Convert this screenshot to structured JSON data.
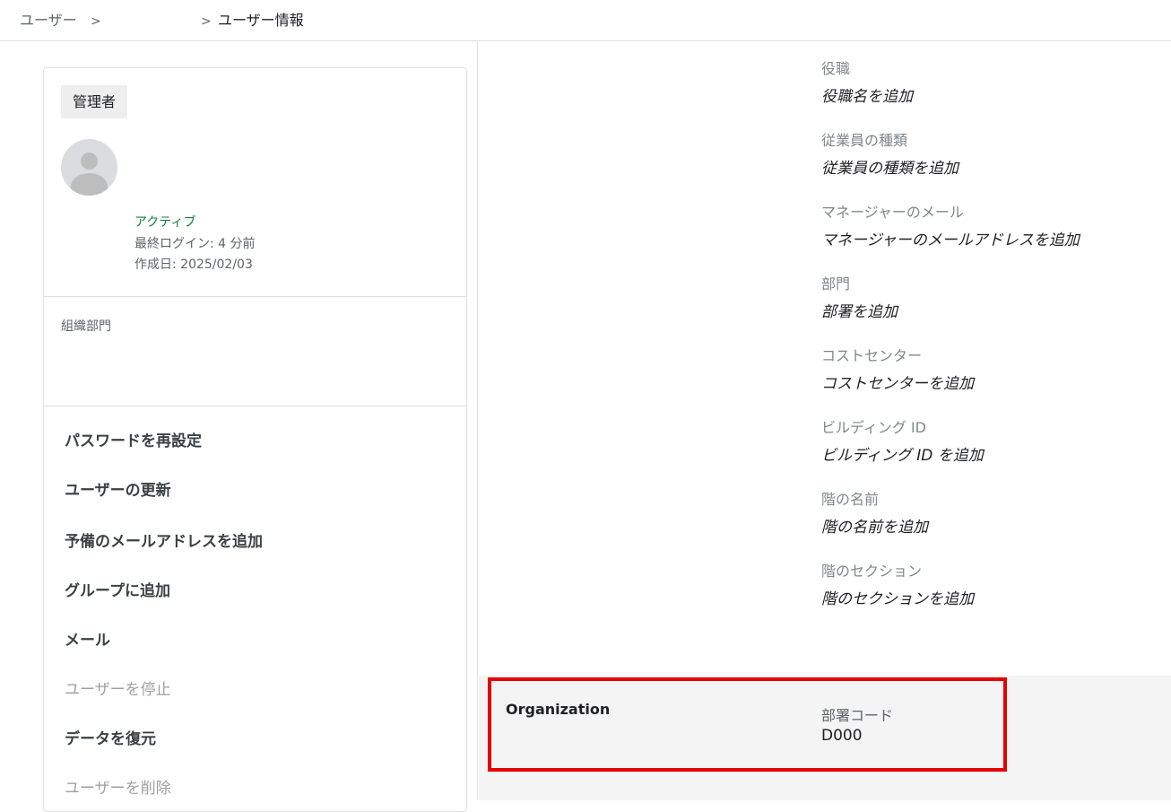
{
  "breadcrumb": {
    "users": "ユーザー",
    "separator": ">",
    "current": "ユーザー情報"
  },
  "profile": {
    "role_badge": "管理者",
    "status": "アクティブ",
    "last_login": "最終ログイン: 4 分前",
    "created": "作成日: 2025/02/03",
    "org_unit_label": "組織部門"
  },
  "actions": [
    {
      "label": "パスワードを再設定",
      "enabled": true
    },
    {
      "label": "ユーザーの更新",
      "enabled": true
    },
    {
      "label": "予備のメールアドレスを追加",
      "enabled": true
    },
    {
      "label": "グループに追加",
      "enabled": true
    },
    {
      "label": "メール",
      "enabled": true
    },
    {
      "label": "ユーザーを停止",
      "enabled": false
    },
    {
      "label": "データを復元",
      "enabled": true
    },
    {
      "label": "ユーザーを削除",
      "enabled": false
    }
  ],
  "fields": [
    {
      "label": "役職",
      "value": "役職名を追加"
    },
    {
      "label": "従業員の種類",
      "value": "従業員の種類を追加"
    },
    {
      "label": "マネージャーのメール",
      "value": "マネージャーのメールアドレスを追加"
    },
    {
      "label": "部門",
      "value": "部署を追加"
    },
    {
      "label": "コストセンター",
      "value": "コストセンターを追加"
    },
    {
      "label": "ビルディング ID",
      "value": "ビルディング ID を追加"
    },
    {
      "label": "階の名前",
      "value": "階の名前を追加"
    },
    {
      "label": "階のセクション",
      "value": "階のセクションを追加"
    }
  ],
  "organization": {
    "title": "Organization",
    "dept_code_label": "部署コード",
    "dept_code_value": "D000"
  },
  "colors": {
    "active_status": "#188038",
    "highlight": "#e60000"
  }
}
